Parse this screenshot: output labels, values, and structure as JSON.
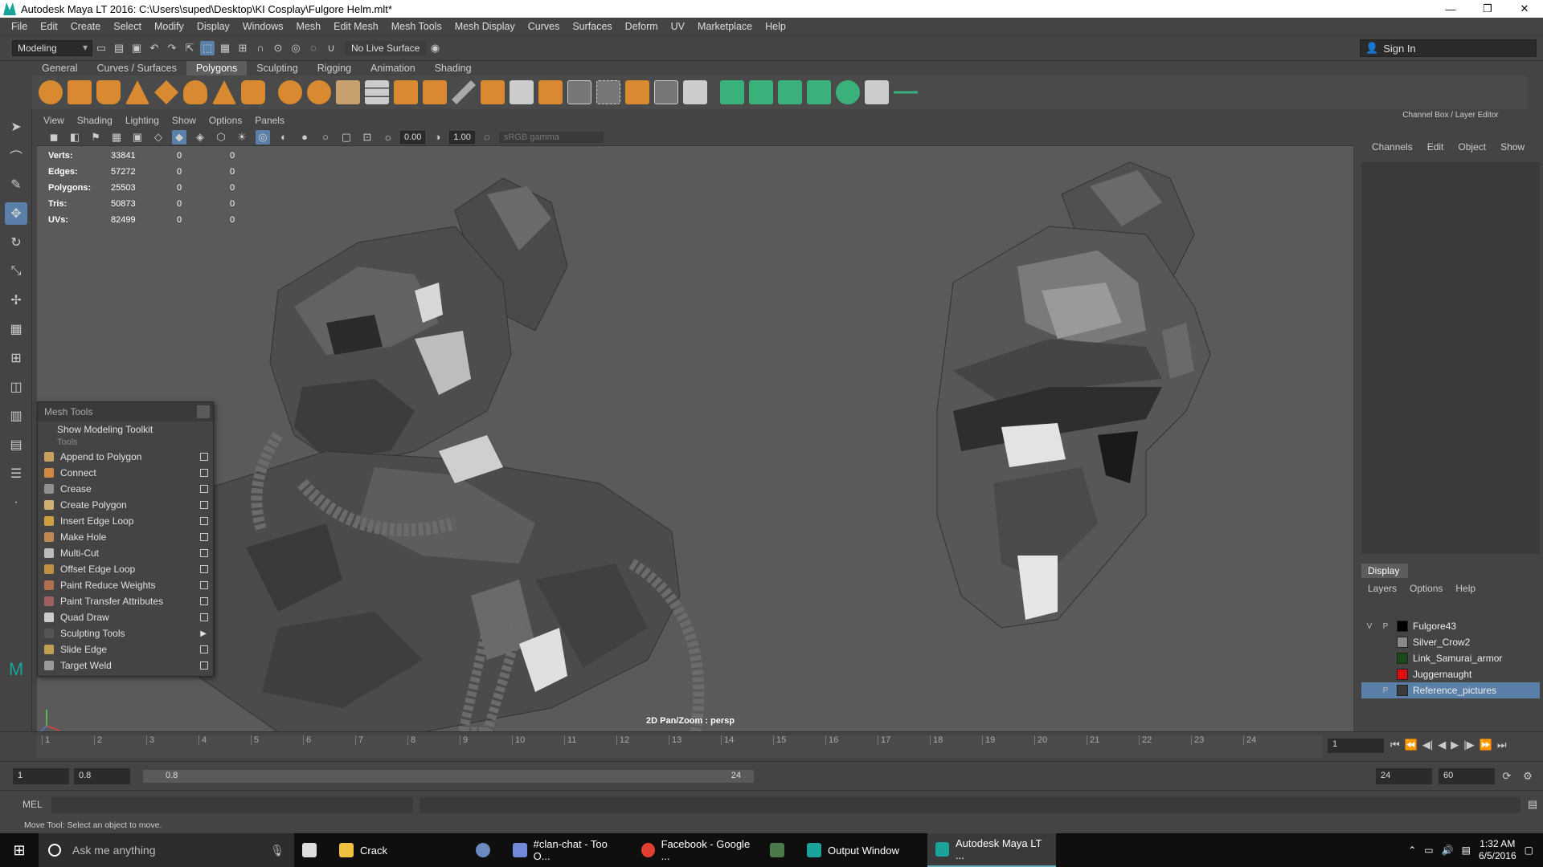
{
  "title": "Autodesk Maya LT 2016: C:\\Users\\suped\\Desktop\\KI Cosplay\\Fulgore Helm.mlt*",
  "window_controls": {
    "minimize": "—",
    "maximize": "❐",
    "close": "✕"
  },
  "menubar": [
    "File",
    "Edit",
    "Create",
    "Select",
    "Modify",
    "Display",
    "Windows",
    "Mesh",
    "Edit Mesh",
    "Mesh Tools",
    "Mesh Display",
    "Curves",
    "Surfaces",
    "Deform",
    "UV",
    "Marketplace",
    "Help"
  ],
  "status": {
    "mode": "Modeling",
    "live_surface": "No Live Surface",
    "sign_in": "Sign In"
  },
  "shelf_tabs": [
    "General",
    "Curves / Surfaces",
    "Polygons",
    "Sculpting",
    "Rigging",
    "Animation",
    "Shading"
  ],
  "shelf_active": "Polygons",
  "viewport": {
    "menu": [
      "View",
      "Shading",
      "Lighting",
      "Show",
      "Options",
      "Panels"
    ],
    "exposure": "0.00",
    "gamma": "1.00",
    "color_space": "sRGB gamma",
    "camera": "2D Pan/Zoom : persp",
    "hud": [
      {
        "label": "Verts:",
        "value": "33841",
        "a": "0",
        "b": "0"
      },
      {
        "label": "Edges:",
        "value": "57272",
        "a": "0",
        "b": "0"
      },
      {
        "label": "Polygons:",
        "value": "25503",
        "a": "0",
        "b": "0"
      },
      {
        "label": "Tris:",
        "value": "50873",
        "a": "0",
        "b": "0"
      },
      {
        "label": "UVs:",
        "value": "82499",
        "a": "0",
        "b": "0"
      }
    ]
  },
  "mesh_tools": {
    "title": "Mesh Tools",
    "show_toolkit": "Show Modeling Toolkit",
    "section": "Tools",
    "items": [
      {
        "label": "Append to Polygon",
        "color": "#c9a060"
      },
      {
        "label": "Connect",
        "color": "#d08840"
      },
      {
        "label": "Crease",
        "color": "#909090"
      },
      {
        "label": "Create Polygon",
        "color": "#d0b070"
      },
      {
        "label": "Insert Edge Loop",
        "color": "#d0a040"
      },
      {
        "label": "Make Hole",
        "color": "#c08850"
      },
      {
        "label": "Multi-Cut",
        "color": "#bbbbbb"
      },
      {
        "label": "Offset Edge Loop",
        "color": "#c09040"
      },
      {
        "label": "Paint Reduce Weights",
        "color": "#b07050"
      },
      {
        "label": "Paint Transfer Attributes",
        "color": "#a06060"
      },
      {
        "label": "Quad Draw",
        "color": "#cccccc"
      },
      {
        "label": "Sculpting Tools",
        "color": "#555555"
      },
      {
        "label": "Slide Edge",
        "color": "#c0a050"
      },
      {
        "label": "Target Weld",
        "color": "#999999"
      }
    ]
  },
  "channel_box": {
    "title": "Channel Box / Layer Editor",
    "menu": [
      "Channels",
      "Edit",
      "Object",
      "Show"
    ],
    "display_tab": "Display",
    "layer_menu": [
      "Layers",
      "Options",
      "Help"
    ],
    "layers": [
      {
        "v": "V",
        "p": "P",
        "name": "Fulgore43",
        "color": "#000000"
      },
      {
        "v": "",
        "p": "",
        "name": "Silver_Crow2",
        "color": "#8a8a8a"
      },
      {
        "v": "",
        "p": "",
        "name": "Link_Samurai_armor",
        "color": "#1a4a1a"
      },
      {
        "v": "",
        "p": "",
        "name": "Juggernaught",
        "color": "#e01010"
      },
      {
        "v": "",
        "p": "P",
        "name": "Reference_pictures",
        "color": "#3a3a3a"
      }
    ]
  },
  "timeline": {
    "ticks": [
      "1",
      "2",
      "3",
      "4",
      "5",
      "6",
      "7",
      "8",
      "9",
      "10",
      "11",
      "12",
      "13",
      "14",
      "15",
      "16",
      "17",
      "18",
      "19",
      "20",
      "21",
      "22",
      "23",
      "24"
    ],
    "current_frame": "1",
    "start": "1",
    "start_inner": "0.8",
    "slider_start": "0.8",
    "slider_end": "24",
    "end_inner": "24",
    "end": "60"
  },
  "mel_label": "MEL",
  "help_text": "Move Tool: Select an object to move.",
  "taskbar": {
    "search": "Ask me anything",
    "items": [
      {
        "label": "Crack",
        "color": "#f0c040"
      },
      {
        "label": "",
        "color": "#6a8ac0"
      },
      {
        "label": "#clan-chat - Too O...",
        "color": "#7289da"
      },
      {
        "label": "Facebook - Google ...",
        "color": "#e04030"
      },
      {
        "label": "",
        "color": "#4a7a4a"
      },
      {
        "label": "Output Window",
        "color": "#1aa39a"
      },
      {
        "label": "Autodesk Maya LT ...",
        "color": "#1aa39a"
      }
    ],
    "time": "1:32 AM",
    "date": "6/5/2016"
  }
}
